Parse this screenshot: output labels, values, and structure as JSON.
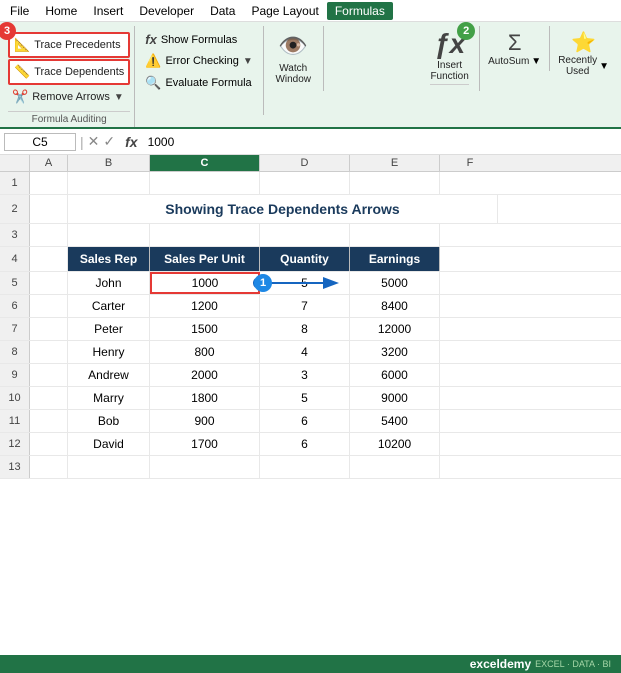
{
  "menu": {
    "items": [
      "File",
      "Home",
      "Insert",
      "Developer",
      "Data",
      "Page Layout",
      "Formulas"
    ]
  },
  "ribbon": {
    "active_tab": "Formulas",
    "groups": {
      "formula_auditing": {
        "title": "Formula Auditing",
        "trace_precedents": "Trace Precedents",
        "trace_dependents": "Trace Dependents",
        "remove_arrows": "Remove Arrows",
        "show_formulas": "Show Formulas",
        "error_checking": "Error Checking",
        "evaluate_formula": "Evaluate Formula"
      },
      "watch_window": {
        "title": "Watch Window",
        "label": "Watch\nWindow"
      },
      "insert_function": {
        "title": "Insert Function",
        "label": "Insert\nFunction"
      },
      "autosum": {
        "title": "AutoSum",
        "label": "AutoSum"
      },
      "recently_used": {
        "title": "Recently Used",
        "label": "Recently\nUsed"
      }
    }
  },
  "formula_bar": {
    "cell_ref": "C5",
    "value": "1000"
  },
  "spreadsheet": {
    "title": "Showing Trace Dependents Arrows",
    "columns": [
      "A",
      "B",
      "C",
      "D",
      "E",
      "F"
    ],
    "col_labels": [
      "",
      "Sales Rep",
      "Sales Per Unit",
      "Quantity",
      "Earnings"
    ],
    "rows": [
      {
        "num": 1,
        "cells": [
          "",
          "",
          "",
          "",
          ""
        ]
      },
      {
        "num": 2,
        "cells": [
          "",
          "Showing Trace Dependents Arrows",
          "",
          "",
          ""
        ]
      },
      {
        "num": 3,
        "cells": [
          "",
          "",
          "",
          "",
          ""
        ]
      },
      {
        "num": 4,
        "cells": [
          "",
          "Sales Rep",
          "Sales Per Unit",
          "Quantity",
          "Earnings"
        ]
      },
      {
        "num": 5,
        "cells": [
          "",
          "John",
          "1000",
          "5",
          "5000"
        ]
      },
      {
        "num": 6,
        "cells": [
          "",
          "Carter",
          "1200",
          "7",
          "8400"
        ]
      },
      {
        "num": 7,
        "cells": [
          "",
          "Peter",
          "1500",
          "8",
          "12000"
        ]
      },
      {
        "num": 8,
        "cells": [
          "",
          "Henry",
          "800",
          "4",
          "3200"
        ]
      },
      {
        "num": 9,
        "cells": [
          "",
          "Andrew",
          "2000",
          "3",
          "6000"
        ]
      },
      {
        "num": 10,
        "cells": [
          "",
          "Marry",
          "1800",
          "5",
          "9000"
        ]
      },
      {
        "num": 11,
        "cells": [
          "",
          "Bob",
          "900",
          "6",
          "5400"
        ]
      },
      {
        "num": 12,
        "cells": [
          "",
          "David",
          "1700",
          "6",
          "10200"
        ]
      },
      {
        "num": 13,
        "cells": [
          "",
          "",
          "",
          "",
          ""
        ]
      }
    ]
  },
  "badges": {
    "badge1": "1",
    "badge2": "2",
    "badge3": "3"
  },
  "status_bar": {
    "brand": "exceldemy",
    "tagline": "EXCEL · DATA · BI"
  }
}
